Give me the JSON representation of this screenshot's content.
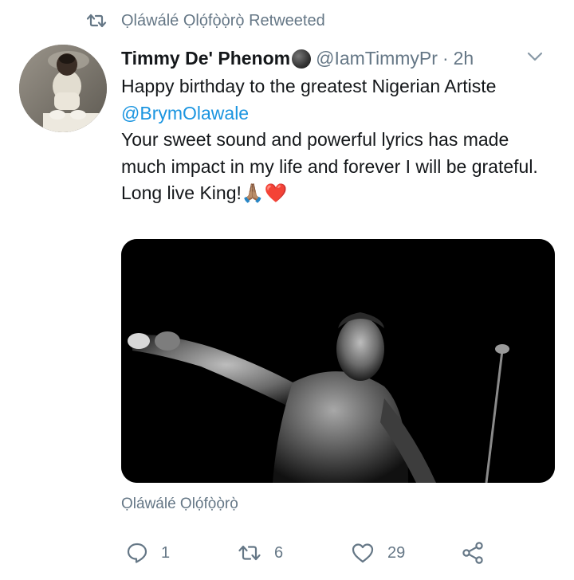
{
  "retweet": {
    "label": "Ọláwálé Ọlọ́fọ̀ọ̀rọ̀ Retweeted",
    "icon": "retweet-icon"
  },
  "tweet": {
    "display_name": "Timmy De' Phenom",
    "handle": "@IamTimmyPr",
    "separator": "·",
    "time": "2h",
    "text_line1": "Happy birthday to the greatest Nigerian Artiste",
    "mention": "@BrymOlawale",
    "text_line3": "Your sweet sound and powerful lyrics has made much impact in my life and forever I will be grateful.",
    "text_line4": "Long live King!🙏🏽❤️",
    "translate_link": "Ọláwálé Ọlọ́fọ̀ọ̀rọ̀"
  },
  "actions": {
    "reply_count": "1",
    "retweet_count": "6",
    "like_count": "29"
  },
  "colors": {
    "text": "#14171a",
    "secondary": "#657786",
    "link": "#1b95e0"
  }
}
